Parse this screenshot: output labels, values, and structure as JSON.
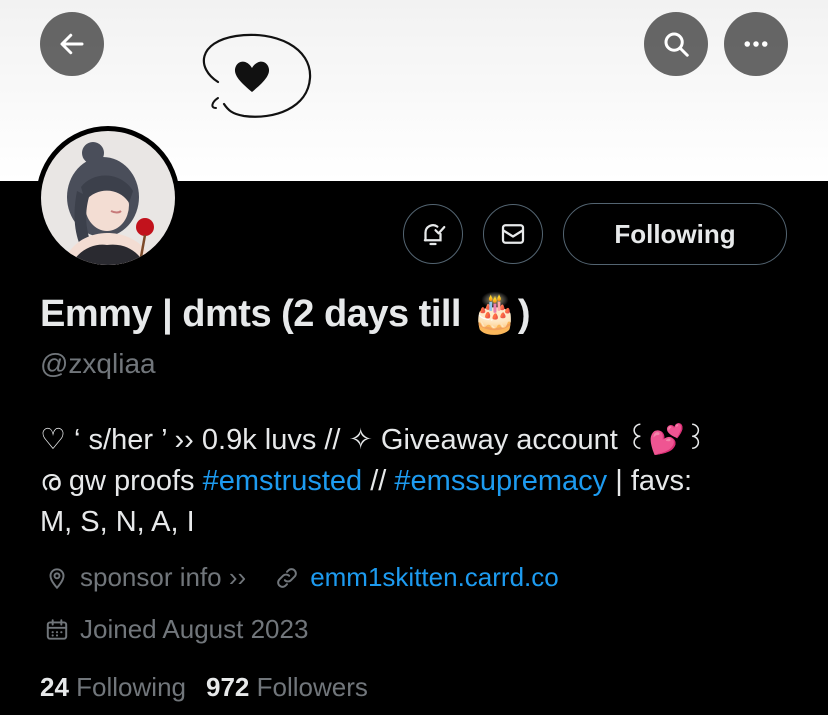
{
  "nav": {
    "back_icon": "arrow-left-icon",
    "search_icon": "search-icon",
    "more_icon": "more-horizontal-icon"
  },
  "banner": {
    "doodle": "heart-speech-bubble"
  },
  "actions": {
    "notify_icon": "bell-check-icon",
    "message_icon": "mail-icon",
    "follow_label": "Following"
  },
  "profile": {
    "name_text": "Emmy | dmts (2 days till ",
    "name_emoji": "🎂",
    "name_close": ")",
    "handle": "@zxqliaa",
    "bio": {
      "line1": "♡ ‘ s/her ’ ›› 0.9k luvs // ✧ Giveaway account ꒰💕꒱",
      "line2_prefix": "ര gw proofs ",
      "tag1": "#emstrusted",
      "line2_mid": " // ",
      "tag2": "#emssupremacy",
      "line2_suffix": " | favs:",
      "line3": "M, S, N, A, I"
    },
    "location": "sponsor info ››",
    "website": "emm1skitten.carrd.co",
    "joined": "Joined August 2023"
  },
  "stats": {
    "following_count": "24",
    "following_label": "Following",
    "followers_count": "972",
    "followers_label": "Followers"
  },
  "colors": {
    "accent": "#1d9bf0",
    "muted": "#71767b",
    "text": "#e7e9ea",
    "background": "#000000",
    "border": "#536471"
  }
}
